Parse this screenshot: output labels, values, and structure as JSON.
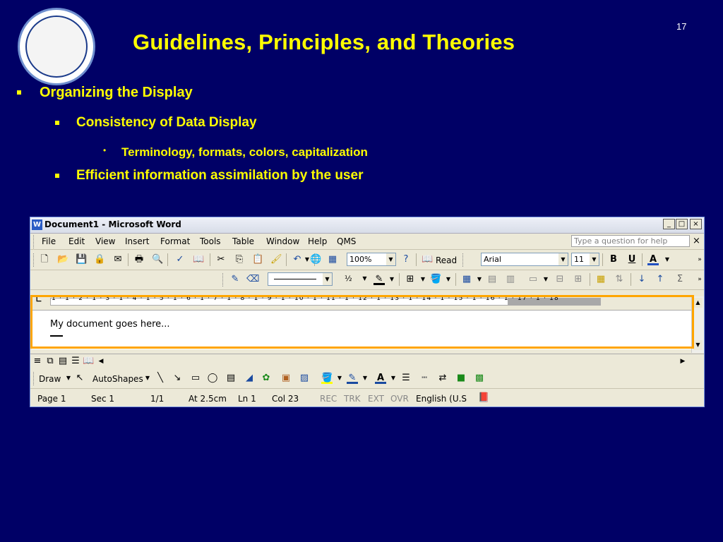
{
  "slide": {
    "title": "Guidelines, Principles, and Theories",
    "page_number": "17",
    "logo_icon": "university-of-delaware-seal",
    "bullets": [
      "Organizing the Display",
      "Consistency of Data Display",
      "Terminology, formats, colors, capitalization",
      "Efficient information assimilation by the user"
    ],
    "colors": {
      "background": "#000066",
      "text": "#ffff00",
      "highlight": "#ffa500"
    }
  },
  "word": {
    "window_title": "Document1 - Microsoft Word",
    "window_buttons": [
      "_",
      "□",
      "×"
    ],
    "menu": [
      "File",
      "Edit",
      "View",
      "Insert",
      "Format",
      "Tools",
      "Table",
      "Window",
      "Help",
      "QMS"
    ],
    "help_placeholder": "Type a question for help",
    "zoom": "100%",
    "read_label": "Read",
    "font_name": "Arial",
    "font_size": "11",
    "bold": "B",
    "underline": "U",
    "font_color": "A",
    "line_width": "½",
    "ruler_ticks": "1 · 1 · 2 · 1 · 3 · 1 · 4 · 1 · 5 · 1 · 6 · 1 · 7 · 1 · 8 · 1 · 9 · 1 · 10 · 1 · 11 · 1 · 12 · 1 · 13 · 1 · 14 · 1 · 15 · 1 · 16 · 1 · 17 · 1 · 18",
    "document_text": "My document goes here...",
    "draw_label": "Draw",
    "autoshapes_label": "AutoShapes",
    "status": {
      "page": "Page  1",
      "sec": "Sec  1",
      "pages": "1/1",
      "at": "At  2.5cm",
      "ln": "Ln  1",
      "col": "Col  23",
      "rec": "REC",
      "trk": "TRK",
      "ext": "EXT",
      "ovr": "OVR",
      "language": "English (U.S"
    }
  }
}
